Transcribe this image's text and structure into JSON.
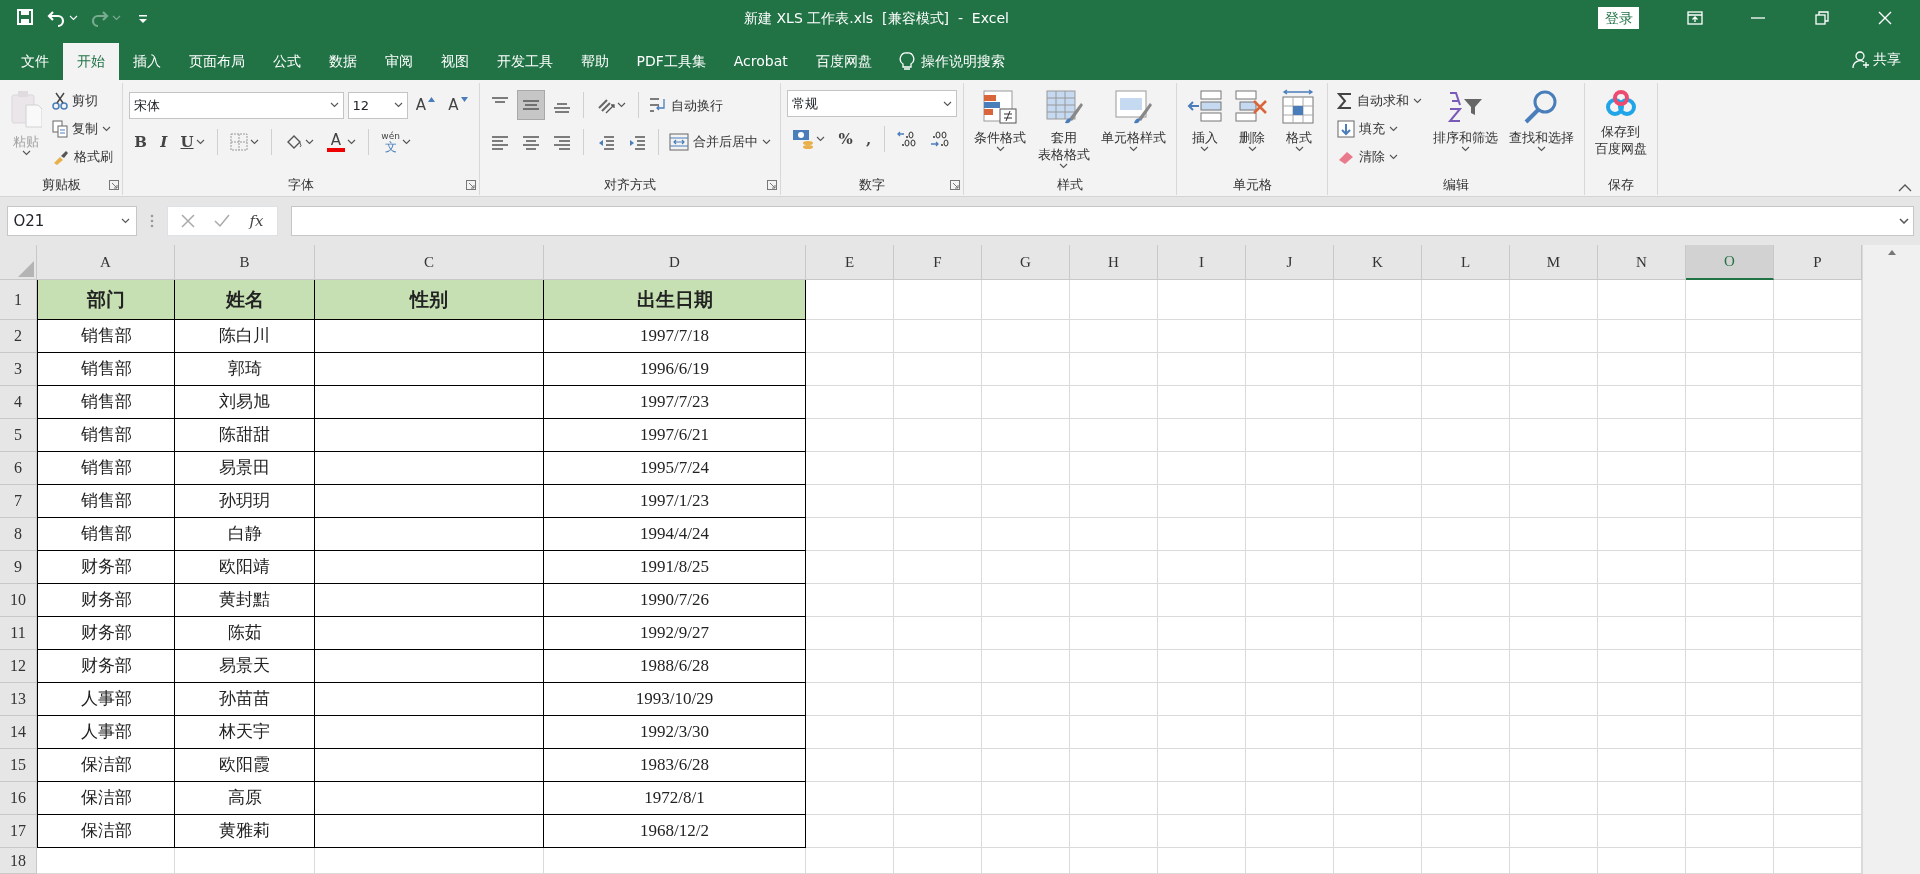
{
  "window": {
    "title": "新建 XLS 工作表.xls  [兼容模式]  -  Excel",
    "login": "登录"
  },
  "quick_access": [
    {
      "kind": "save",
      "disabled": false,
      "caret": false
    },
    {
      "kind": "undo",
      "disabled": false,
      "caret": true
    },
    {
      "kind": "redo",
      "disabled": true,
      "caret": true
    },
    {
      "kind": "customize",
      "disabled": false,
      "caret": false
    }
  ],
  "tabs": [
    {
      "label": "文件",
      "selected": false
    },
    {
      "label": "开始",
      "selected": true
    },
    {
      "label": "插入",
      "selected": false
    },
    {
      "label": "页面布局",
      "selected": false
    },
    {
      "label": "公式",
      "selected": false
    },
    {
      "label": "数据",
      "selected": false
    },
    {
      "label": "审阅",
      "selected": false
    },
    {
      "label": "视图",
      "selected": false
    },
    {
      "label": "开发工具",
      "selected": false
    },
    {
      "label": "帮助",
      "selected": false
    },
    {
      "label": "PDF工具集",
      "selected": false
    },
    {
      "label": "Acrobat",
      "selected": false
    },
    {
      "label": "百度网盘",
      "selected": false
    }
  ],
  "tell_me": "操作说明搜索",
  "share": "共享",
  "ribbon": [
    {
      "label": "剪贴板",
      "launcher": true,
      "items": [
        {
          "kind": "large",
          "label": "粘贴",
          "disabled": true,
          "caret": true
        },
        {
          "kind": "stack",
          "rows": [
            {
              "kind": "button",
              "label": "剪切",
              "caret": false
            },
            {
              "kind": "button",
              "label": "复制",
              "caret": true
            },
            {
              "kind": "button",
              "label": "格式刷",
              "caret": false
            }
          ]
        }
      ]
    },
    {
      "label": "字体",
      "launcher": true,
      "items": [
        {
          "kind": "rows",
          "rows": [
            [
              {
                "kind": "combo",
                "value": "宋体",
                "wide": true
              },
              {
                "kind": "combo",
                "value": "12",
                "wide": false
              },
              {
                "kind": "glyph",
                "label": "A",
                "caret": false
              },
              {
                "kind": "glyph",
                "label": "A",
                "caret": false
              }
            ],
            [
              {
                "kind": "tool",
                "label": "B",
                "caret": false
              },
              {
                "kind": "tool",
                "label": "I",
                "caret": false
              },
              {
                "kind": "tool",
                "label": "U",
                "caret": true
              },
              {
                "kind": "divider"
              },
              {
                "kind": "tool",
                "caret": true
              },
              {
                "kind": "divider"
              },
              {
                "kind": "tool",
                "caret": true
              },
              {
                "kind": "swatch",
                "label": "A",
                "caret": true
              },
              {
                "kind": "divider"
              },
              {
                "kind": "stacked",
                "label": "wén",
                "label2": "文",
                "caret": true
              }
            ]
          ]
        }
      ]
    },
    {
      "label": "对齐方式",
      "launcher": true,
      "items": [
        {
          "kind": "rows",
          "rows": [
            [
              {
                "kind": "tool",
                "selected": false,
                "caret": false
              },
              {
                "kind": "tool",
                "selected": true,
                "caret": false
              },
              {
                "kind": "tool",
                "selected": false,
                "caret": false
              },
              {
                "kind": "divider"
              },
              {
                "kind": "tool",
                "caret": true
              },
              {
                "kind": "divider"
              },
              {
                "kind": "button",
                "label": "自动换行",
                "caret": false
              }
            ],
            [
              {
                "kind": "tool",
                "caret": false
              },
              {
                "kind": "tool",
                "caret": false
              },
              {
                "kind": "tool",
                "caret": false
              },
              {
                "kind": "divider"
              },
              {
                "kind": "tool",
                "caret": false
              },
              {
                "kind": "tool",
                "caret": false
              },
              {
                "kind": "divider"
              },
              {
                "kind": "button",
                "label": "合并后居中",
                "caret": true
              }
            ]
          ]
        }
      ]
    },
    {
      "label": "数字",
      "launcher": true,
      "items": [
        {
          "kind": "rows",
          "rows": [
            [
              {
                "kind": "combo",
                "value": "常规",
                "wide": true
              }
            ],
            [
              {
                "kind": "tool",
                "caret": true
              },
              {
                "kind": "tool",
                "label": "%",
                "caret": false
              },
              {
                "kind": "tool",
                "label": ",",
                "caret": false
              },
              {
                "kind": "divider"
              },
              {
                "kind": "tool",
                "caret": false
              },
              {
                "kind": "tool",
                "caret": false
              }
            ]
          ]
        }
      ]
    },
    {
      "label": "样式",
      "launcher": false,
      "items": [
        {
          "kind": "large",
          "label": "条件格式",
          "disabled": false,
          "caret": true
        },
        {
          "kind": "large",
          "label": "套用",
          "label2": "表格格式",
          "disabled": false,
          "caret": true
        },
        {
          "kind": "large",
          "label": "单元格样式",
          "disabled": false,
          "caret": true
        }
      ]
    },
    {
      "label": "单元格",
      "launcher": false,
      "items": [
        {
          "kind": "large",
          "label": "插入",
          "disabled": false,
          "caret": true
        },
        {
          "kind": "large",
          "label": "删除",
          "disabled": false,
          "caret": true
        },
        {
          "kind": "large",
          "label": "格式",
          "disabled": false,
          "caret": true
        }
      ]
    },
    {
      "label": "编辑",
      "launcher": false,
      "items": [
        {
          "kind": "stack",
          "rows": [
            {
              "kind": "button",
              "label": "自动求和",
              "caret": true
            },
            {
              "kind": "button",
              "label": "填充",
              "caret": true
            },
            {
              "kind": "button",
              "label": "清除",
              "caret": true
            }
          ]
        },
        {
          "kind": "large",
          "label": "排序和筛选",
          "disabled": false,
          "caret": true
        },
        {
          "kind": "large",
          "label": "查找和选择",
          "disabled": false,
          "caret": true
        }
      ]
    },
    {
      "label": "保存",
      "launcher": false,
      "items": [
        {
          "kind": "large",
          "label": "保存到",
          "label2": "百度网盘",
          "disabled": false,
          "caret": false
        }
      ]
    }
  ],
  "formula_bar": {
    "name_box": "O21",
    "function_label": "fx"
  },
  "sheet": {
    "columns": [
      {
        "label": "A",
        "selected": false
      },
      {
        "label": "B",
        "selected": false
      },
      {
        "label": "C",
        "selected": false
      },
      {
        "label": "D",
        "selected": false
      },
      {
        "label": "E",
        "selected": false
      },
      {
        "label": "F",
        "selected": false
      },
      {
        "label": "G",
        "selected": false
      },
      {
        "label": "H",
        "selected": false
      },
      {
        "label": "I",
        "selected": false
      },
      {
        "label": "J",
        "selected": false
      },
      {
        "label": "K",
        "selected": false
      },
      {
        "label": "L",
        "selected": false
      },
      {
        "label": "M",
        "selected": false
      },
      {
        "label": "N",
        "selected": false
      },
      {
        "label": "O",
        "selected": true
      },
      {
        "label": "P",
        "selected": false
      }
    ],
    "row_numbers": [
      "1",
      "2",
      "3",
      "4",
      "5",
      "6",
      "7",
      "8",
      "9",
      "10",
      "11",
      "12",
      "13",
      "14",
      "15",
      "16",
      "17",
      "18"
    ],
    "header": {
      "department": "部门",
      "name": "姓名",
      "gender": "性别",
      "birth_date": "出生日期"
    },
    "rows": [
      {
        "department": "销售部",
        "name": "陈白川",
        "birth_date": "1997/7/18"
      },
      {
        "department": "销售部",
        "name": "郭琦",
        "birth_date": "1996/6/19"
      },
      {
        "department": "销售部",
        "name": "刘易旭",
        "birth_date": "1997/7/23"
      },
      {
        "department": "销售部",
        "name": "陈甜甜",
        "birth_date": "1997/6/21"
      },
      {
        "department": "销售部",
        "name": "易景田",
        "birth_date": "1995/7/24"
      },
      {
        "department": "销售部",
        "name": "孙玥玥",
        "birth_date": "1997/1/23"
      },
      {
        "department": "销售部",
        "name": "白静",
        "birth_date": "1994/4/24"
      },
      {
        "department": "财务部",
        "name": "欧阳靖",
        "birth_date": "1991/8/25"
      },
      {
        "department": "财务部",
        "name": "黄封黠",
        "birth_date": "1990/7/26"
      },
      {
        "department": "财务部",
        "name": "陈茹",
        "birth_date": "1992/9/27"
      },
      {
        "department": "财务部",
        "name": "易景天",
        "birth_date": "1988/6/28"
      },
      {
        "department": "人事部",
        "name": "孙苗苗",
        "birth_date": "1993/10/29"
      },
      {
        "department": "人事部",
        "name": "林天宇",
        "birth_date": "1992/3/30"
      },
      {
        "department": "保洁部",
        "name": "欧阳霞",
        "birth_date": "1983/6/28"
      },
      {
        "department": "保洁部",
        "name": "高原",
        "birth_date": "1972/8/1"
      },
      {
        "department": "保洁部",
        "name": "黄雅莉",
        "birth_date": "1968/12/2"
      }
    ]
  }
}
